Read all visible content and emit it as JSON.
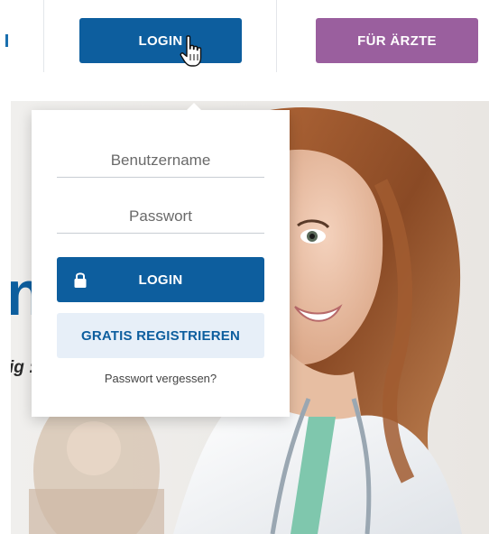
{
  "nav": {
    "login_label": "LOGIN",
    "doctors_label": "FÜR ÄRZTE",
    "colors": {
      "primary": "#0d5e9e",
      "doctors": "#9a5f9e"
    }
  },
  "hero": {
    "partial_title": "n",
    "partial_subtitle": "ig :"
  },
  "login_panel": {
    "username_placeholder": "Benutzername",
    "password_placeholder": "Passwort",
    "login_label": "LOGIN",
    "register_label": "GRATIS REGISTRIEREN",
    "forgot_label": "Passwort vergessen?",
    "icons": {
      "login_button": "lock-icon",
      "cursor": "hand-pointer-icon"
    },
    "colors": {
      "register_bg": "#e7eff8"
    }
  }
}
